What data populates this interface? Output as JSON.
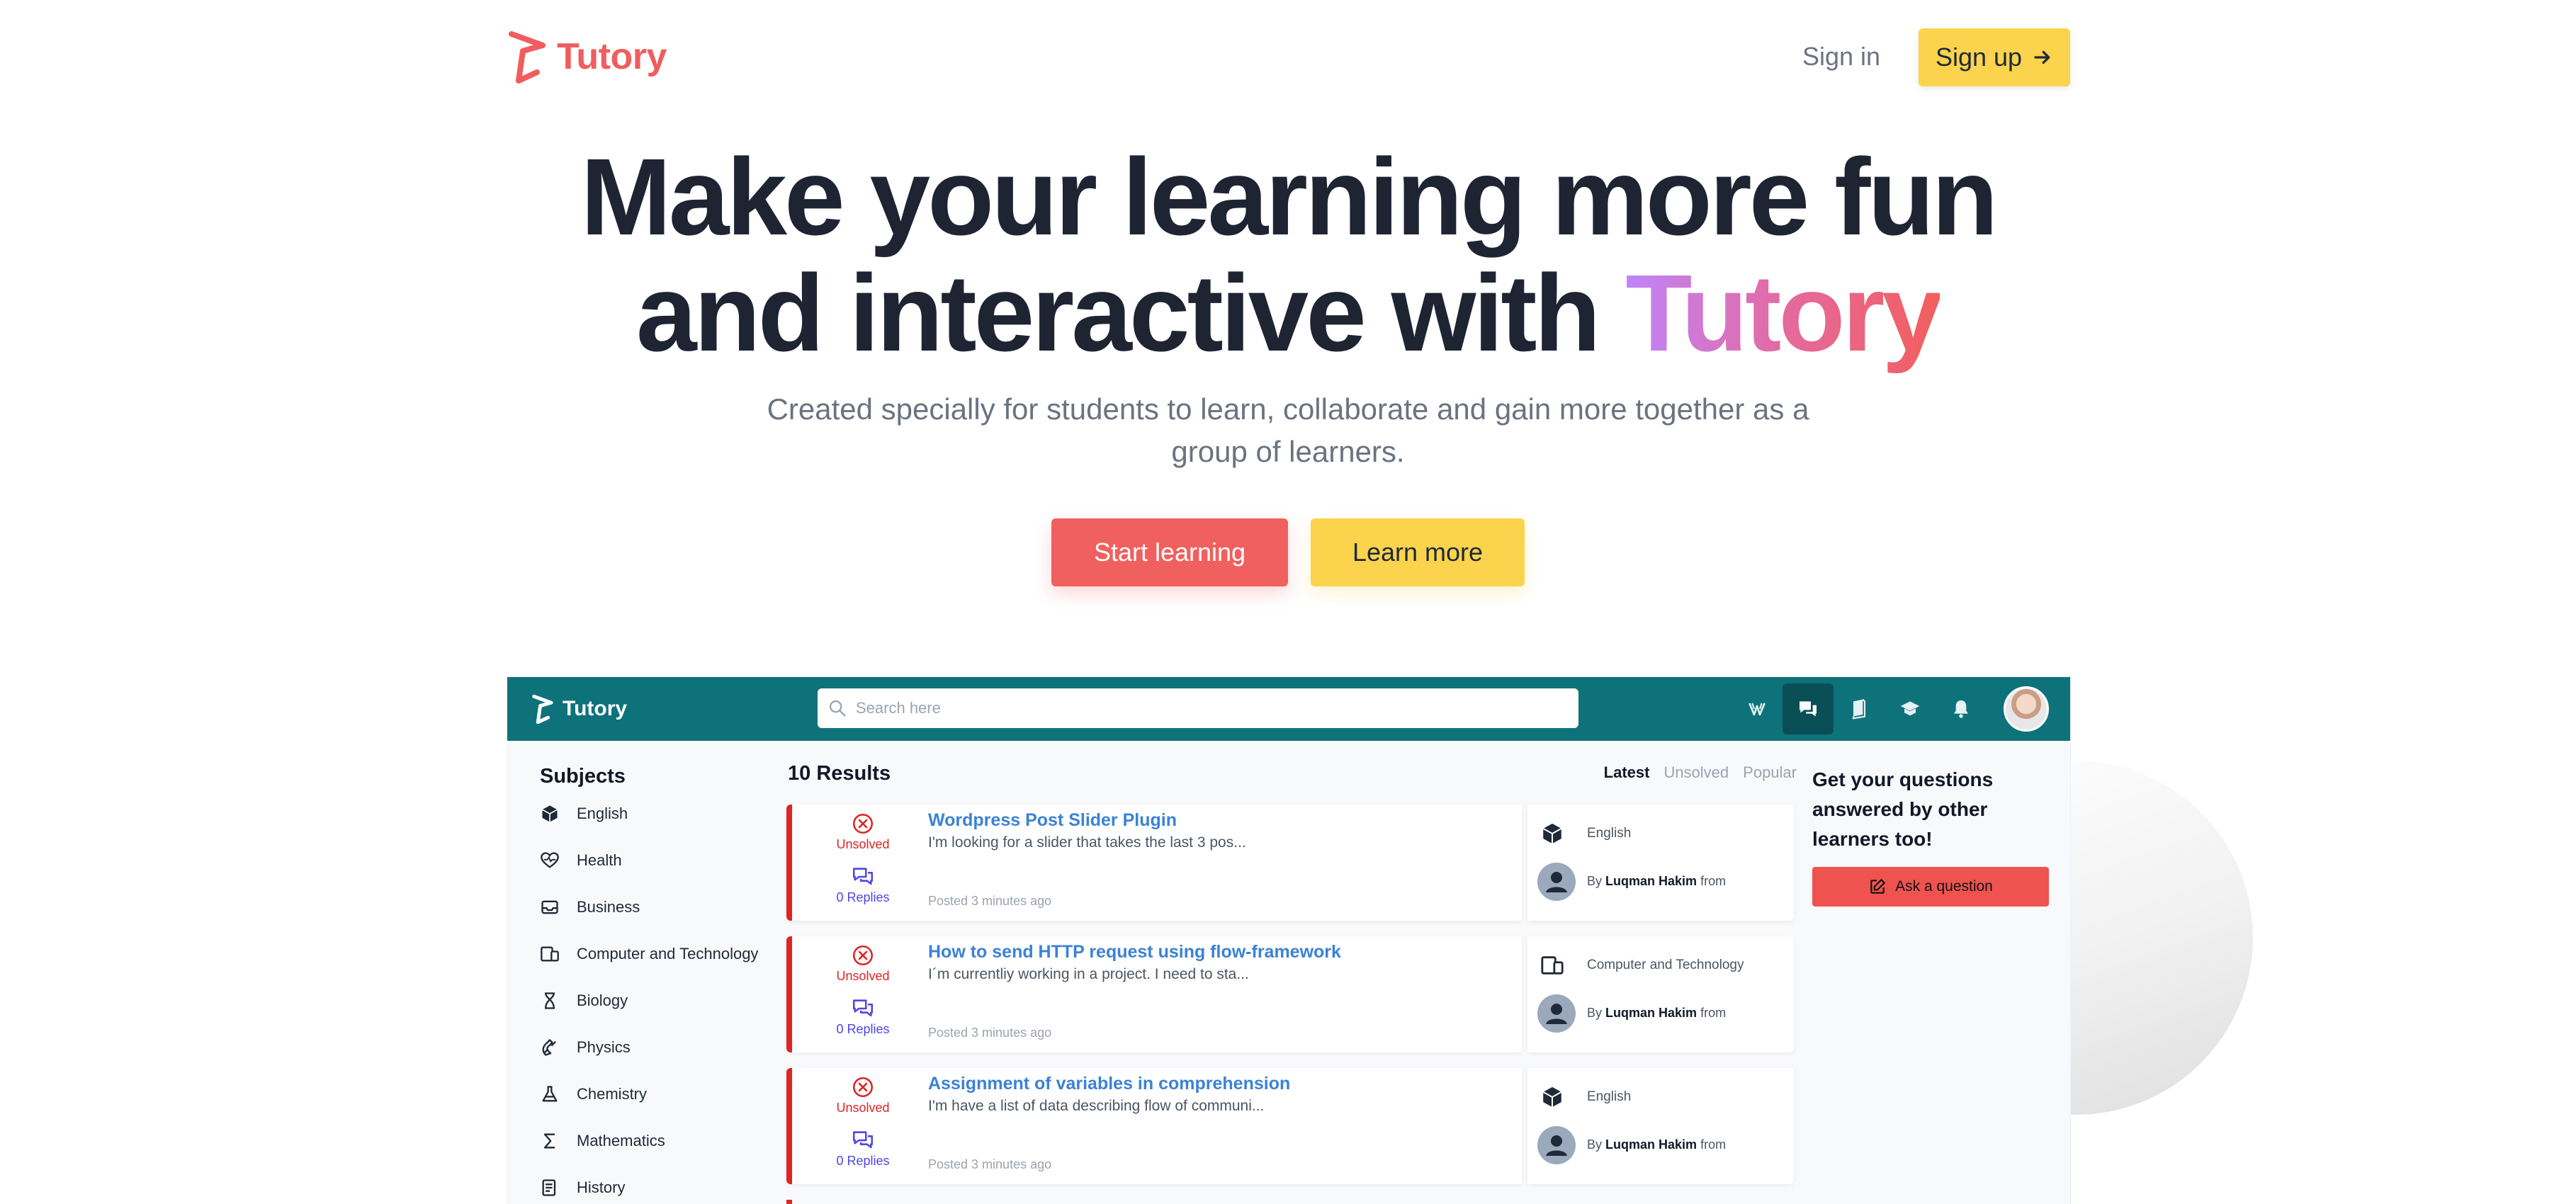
{
  "brand": {
    "name": "Tutory",
    "accent": "#f05d5e"
  },
  "nav": {
    "signin": "Sign in",
    "signup": "Sign up"
  },
  "hero": {
    "line1": "Make your learning more fun",
    "line2_prefix": "and interactive with",
    "line2_brand": "Tutory",
    "subtitle": "Created specially for students to learn, collaborate and gain more together as a group of learners.",
    "start_btn": "Start learning",
    "learn_btn": "Learn more"
  },
  "app": {
    "brand": "Tutory",
    "search_placeholder": "Search here",
    "top_icons": [
      "leaves-icon",
      "chat-icon",
      "book-icon",
      "graduation-cap-icon",
      "bell-icon"
    ],
    "colors": {
      "bar": "#0e727b",
      "unsolved": "#e02424",
      "link": "#3b82d6",
      "replies": "#4f46e5"
    },
    "sidebar": {
      "title": "Subjects",
      "items": [
        {
          "label": "English",
          "icon": "cube-icon"
        },
        {
          "label": "Health",
          "icon": "heart-pulse-icon"
        },
        {
          "label": "Business",
          "icon": "inbox-icon"
        },
        {
          "label": "Computer and Technology",
          "icon": "devices-icon"
        },
        {
          "label": "Biology",
          "icon": "hourglass-icon"
        },
        {
          "label": "Physics",
          "icon": "magnet-icon"
        },
        {
          "label": "Chemistry",
          "icon": "flask-icon"
        },
        {
          "label": "Mathematics",
          "icon": "sigma-icon"
        },
        {
          "label": "History",
          "icon": "scroll-icon"
        }
      ]
    },
    "results": {
      "count": "10 Results",
      "filters": [
        "Latest",
        "Unsolved",
        "Popular"
      ],
      "active_filter": "Latest"
    },
    "questions": [
      {
        "status": "Unsolved",
        "replies": "0 Replies",
        "title": "Wordpress Post Slider Plugin",
        "excerpt": "I'm looking for a slider that takes the last 3 pos...",
        "time": "Posted 3 minutes ago",
        "subject": "English",
        "by_prefix": "By",
        "author": "Luqman Hakim",
        "by_suffix": "from"
      },
      {
        "status": "Unsolved",
        "replies": "0 Replies",
        "title": "How to send HTTP request using flow-framework",
        "excerpt": "I´m currentliy working in a project. I need to sta...",
        "time": "Posted 3 minutes ago",
        "subject": "Computer and Technology",
        "by_prefix": "By",
        "author": "Luqman Hakim",
        "by_suffix": "from"
      },
      {
        "status": "Unsolved",
        "replies": "0 Replies",
        "title": "Assignment of variables in comprehension",
        "excerpt": "I'm have a list of data describing flow of communi...",
        "time": "Posted 3 minutes ago",
        "subject": "English",
        "by_prefix": "By",
        "author": "Luqman Hakim",
        "by_suffix": "from"
      }
    ],
    "ask": {
      "text": "Get your questions answered by other learners too!",
      "button": "Ask a question"
    }
  }
}
